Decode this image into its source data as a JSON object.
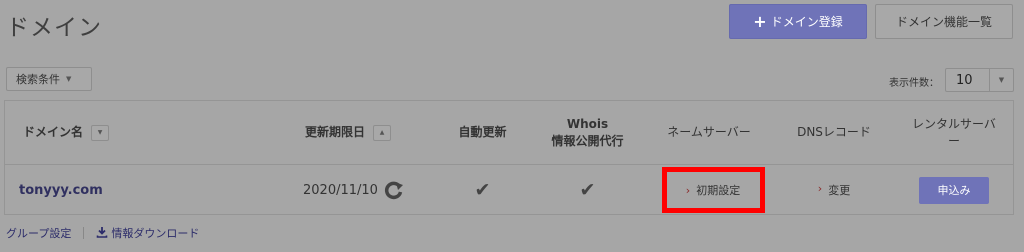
{
  "page": {
    "title": "ドメイン"
  },
  "header": {
    "register_label": "ドメイン登録",
    "register_icon": "plus-icon",
    "function_list_label": "ドメイン機能一覧"
  },
  "filter": {
    "label": "検索条件"
  },
  "per_page": {
    "label": "表示件数：",
    "value": "10"
  },
  "table": {
    "headers": {
      "domain": "ドメイン名",
      "expiry": "更新期限日",
      "auto_renew": "自動更新",
      "whois_line1": "Whois",
      "whois_line2": "情報公開代行",
      "nameserver": "ネームサーバー",
      "dns": "DNSレコード",
      "rental_line1": "レンタルサーバ",
      "rental_line2": "ー"
    },
    "rows": [
      {
        "domain": "tonyyy.com",
        "expiry": "2020/11/10",
        "auto_renew": "✔",
        "whois": "✔",
        "nameserver": "初期設定",
        "dns": "変更",
        "rental": "申込み"
      }
    ]
  },
  "footer": {
    "group_settings": "グループ設定",
    "download": "情報ダウンロード"
  },
  "colors": {
    "accent": "#6f73b8",
    "highlight_box": "#ff0000"
  }
}
